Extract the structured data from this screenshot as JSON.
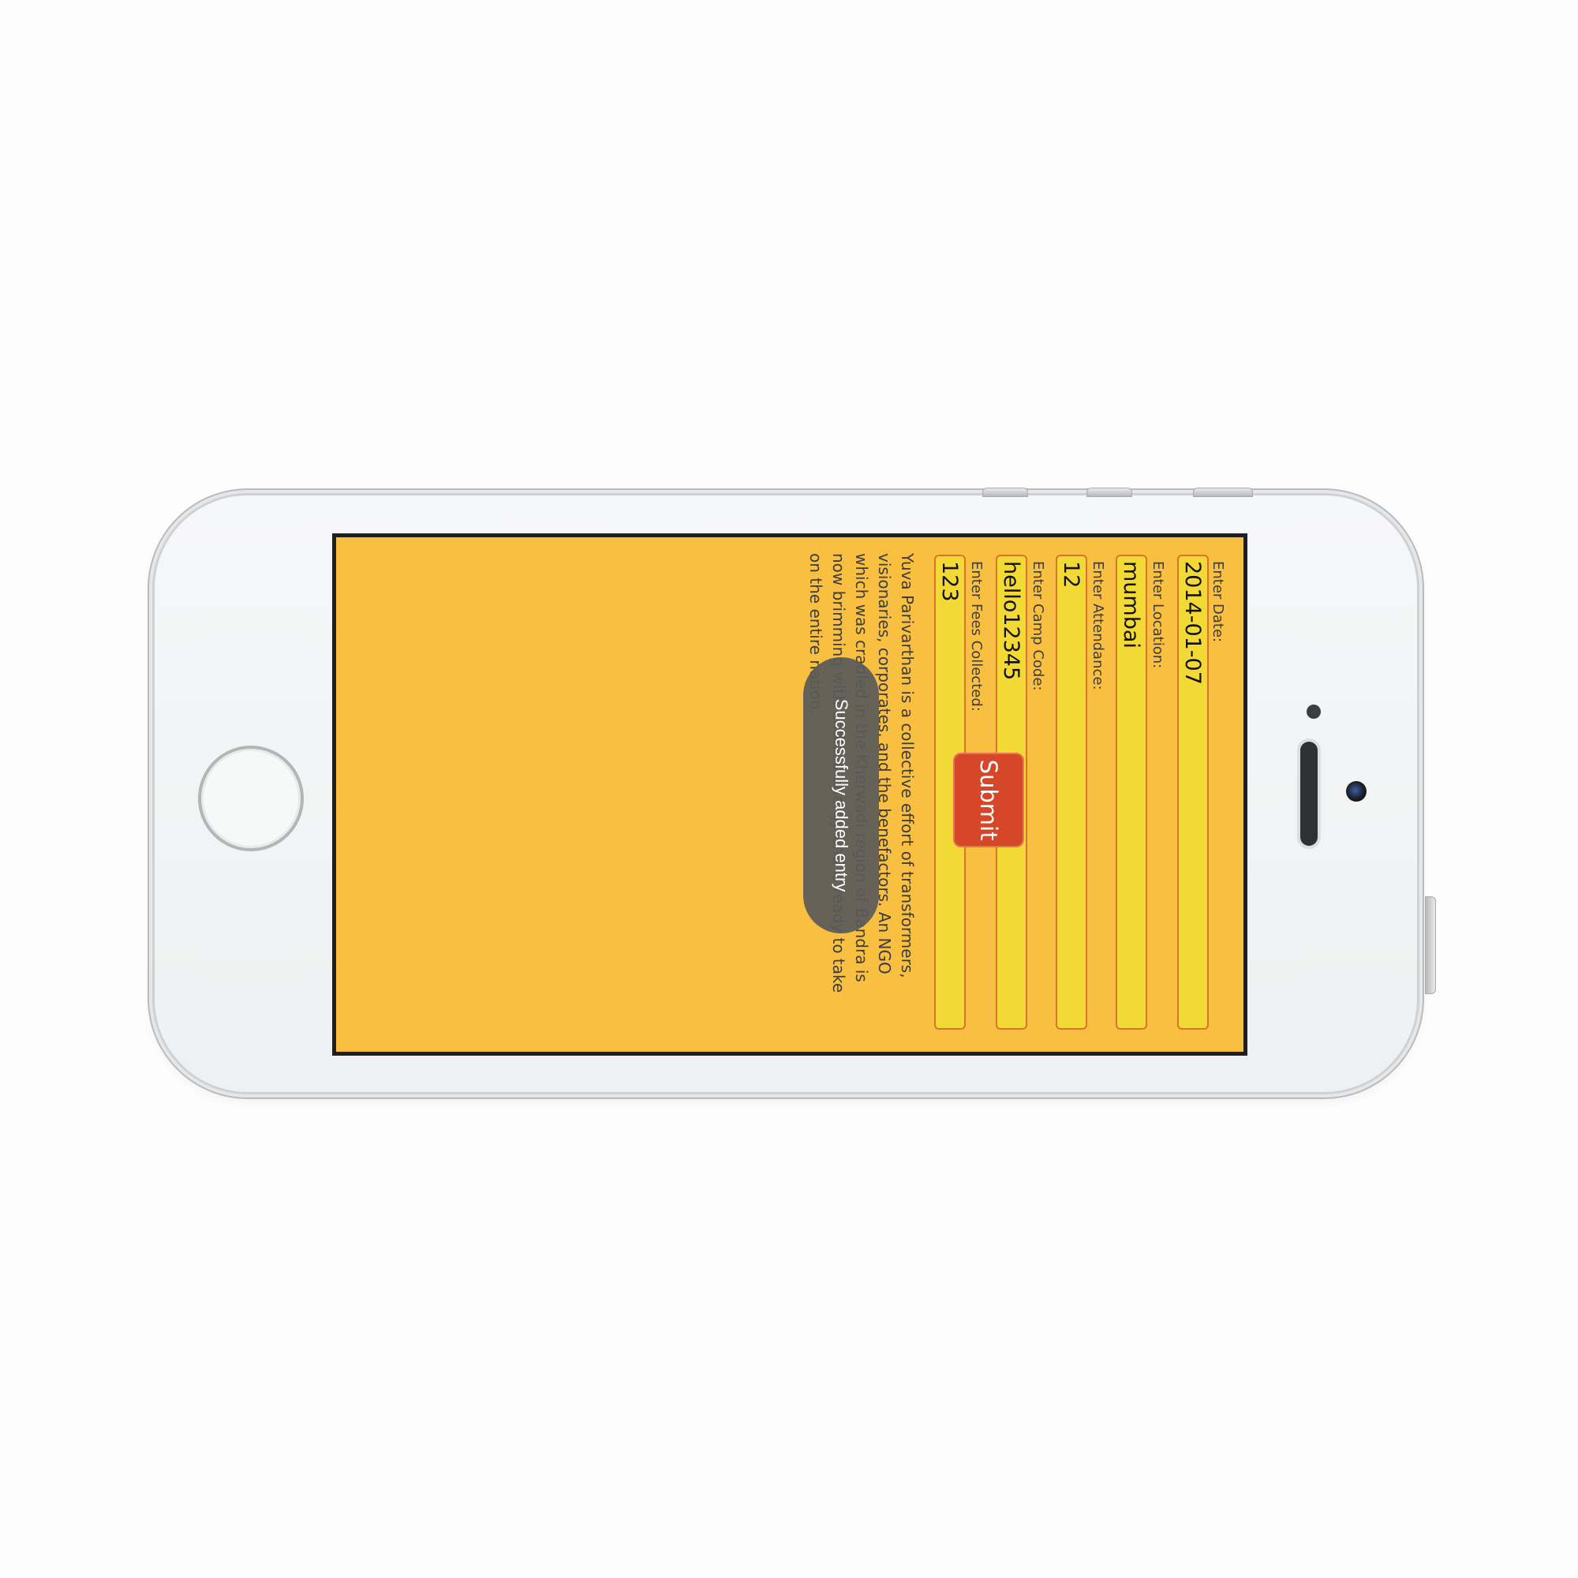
{
  "form": {
    "fields": [
      {
        "label": "Enter Date:",
        "value": "2014-01-07"
      },
      {
        "label": "Enter Location:",
        "value": "mumbai"
      },
      {
        "label": "Enter Attendance:",
        "value": "12"
      },
      {
        "label": "Enter Camp Code:",
        "value": "hello12345"
      },
      {
        "label": "Enter Fees Collected:",
        "value": "123"
      }
    ],
    "submit_label": "Submit"
  },
  "about": {
    "text": "Yuva Parivarthan is a collective effort of transformers, visionaries, corporates, and the benefactors. An NGO which was cradled in the Kherwadi region of Bandra is now brimming with endless energy and is ready to take on the entire nation."
  },
  "toast": {
    "message": "Successfully added entry"
  },
  "colors": {
    "app_background": "#f9bf41",
    "input_background": "#f3d935",
    "input_border": "#d9752a",
    "submit_button": "#d6472a",
    "toast_background": "#5a5a5a"
  }
}
